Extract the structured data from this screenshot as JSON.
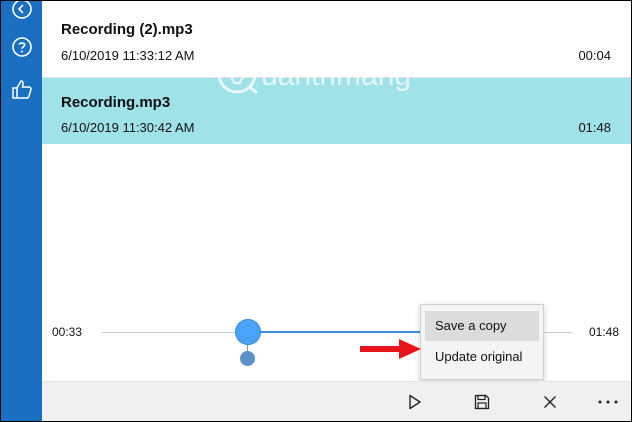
{
  "sidebar": {
    "icons": [
      "back-icon",
      "help-icon",
      "feedback-icon"
    ]
  },
  "recordings": [
    {
      "name": "Recording (2).mp3",
      "date": "6/10/2019 11:33:12 AM",
      "duration": "00:04"
    },
    {
      "name": "Recording.mp3",
      "date": "6/10/2019 11:30:42 AM",
      "duration": "01:48"
    }
  ],
  "player": {
    "current_time": "00:33",
    "total_time": "01:48",
    "progress": 0.31
  },
  "context_menu": {
    "items": [
      "Save a copy",
      "Update original"
    ]
  },
  "toolbar": {
    "icons": [
      "play-icon",
      "save-icon",
      "close-icon",
      "more-icon"
    ]
  },
  "colors": {
    "sidebar": "#1a6fc2",
    "selected_row": "#9fe2e8",
    "accent": "#4aa3f7",
    "arrow": "#e8141b"
  },
  "watermark": {
    "text": "uantrimang"
  }
}
